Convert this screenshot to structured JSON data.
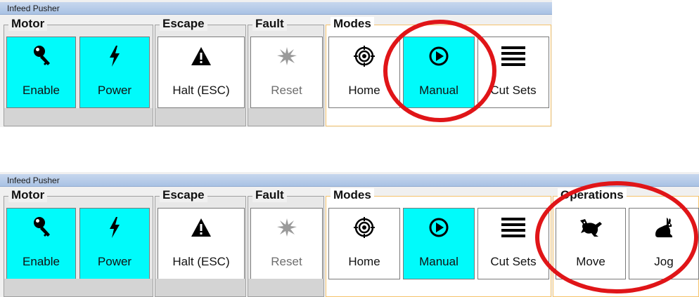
{
  "colors": {
    "active": "#00fbfb",
    "accent_border": "#f5c26b",
    "annotation": "#e01518",
    "titlebar": "#a9c2e4"
  },
  "panels": [
    {
      "window_title": "Infeed Pusher",
      "groups": {
        "motor": {
          "label": "Motor",
          "buttons": [
            {
              "label": "Enable",
              "icon": "key-icon",
              "active": true
            },
            {
              "label": "Power",
              "icon": "lightning-icon",
              "active": true
            }
          ]
        },
        "escape": {
          "label": "Escape",
          "buttons": [
            {
              "label": "Halt (ESC)",
              "icon": "warning-icon"
            }
          ]
        },
        "fault": {
          "label": "Fault",
          "buttons": [
            {
              "label": "Reset",
              "icon": "burst-icon",
              "disabled": true
            }
          ]
        },
        "modes": {
          "label": "Modes",
          "buttons": [
            {
              "label": "Home",
              "icon": "target-icon"
            },
            {
              "label": "Manual",
              "icon": "play-icon",
              "active": true
            },
            {
              "label": "Cut Sets",
              "icon": "list-icon"
            }
          ]
        }
      }
    },
    {
      "window_title": "Infeed Pusher",
      "groups": {
        "motor": {
          "label": "Motor",
          "buttons": [
            {
              "label": "Enable",
              "icon": "key-icon",
              "active": true
            },
            {
              "label": "Power",
              "icon": "lightning-icon",
              "active": true
            }
          ]
        },
        "escape": {
          "label": "Escape",
          "buttons": [
            {
              "label": "Halt (ESC)",
              "icon": "warning-icon"
            }
          ]
        },
        "fault": {
          "label": "Fault",
          "buttons": [
            {
              "label": "Reset",
              "icon": "burst-icon",
              "disabled": true
            }
          ]
        },
        "modes": {
          "label": "Modes",
          "buttons": [
            {
              "label": "Home",
              "icon": "target-icon"
            },
            {
              "label": "Manual",
              "icon": "play-icon",
              "active": true
            },
            {
              "label": "Cut Sets",
              "icon": "list-icon"
            }
          ]
        },
        "operations": {
          "label": "Operations",
          "buttons": [
            {
              "label": "Move",
              "icon": "hare-icon"
            },
            {
              "label": "Jog",
              "icon": "rabbit-icon"
            }
          ]
        }
      }
    }
  ]
}
